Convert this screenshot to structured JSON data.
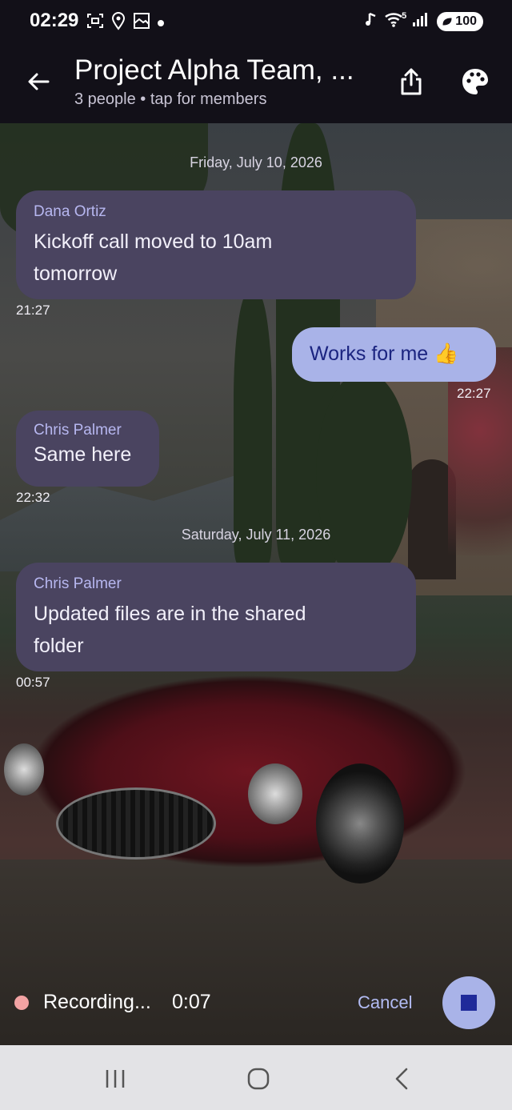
{
  "status_bar": {
    "time": "02:29",
    "left_icons": [
      "screenshot-icon",
      "location-icon",
      "gallery-icon",
      "dot-icon"
    ],
    "right_icons": [
      "music-icon",
      "wifi-icon",
      "signal-icon"
    ],
    "wifi_badge": "5",
    "battery": "100"
  },
  "header": {
    "title": "Project Alpha Team, ...",
    "subtitle": "3 people • tap for members",
    "back_icon": "arrow-left-icon",
    "share_icon": "share-icon",
    "palette_icon": "palette-icon"
  },
  "chat": {
    "date_separators": [
      "Friday, July 10, 2026",
      "Saturday, July 11, 2026"
    ],
    "messages": [
      {
        "direction": "in",
        "sender": "Dana Ortiz",
        "text_line1": "Kickoff call moved to 10am",
        "text_line2": "tomorrow",
        "time": "21:27"
      },
      {
        "direction": "out",
        "text": "Works for me 👍",
        "time": "22:27"
      },
      {
        "direction": "in",
        "sender": "Chris Palmer",
        "text": "Same here",
        "time": "22:32"
      },
      {
        "direction": "in",
        "sender": "Chris Palmer",
        "text_line1": "Updated files are in the shared",
        "text_line2": "folder",
        "time": "00:57"
      }
    ]
  },
  "recorder": {
    "label": "Recording...",
    "timer": "0:07",
    "cancel_label": "Cancel",
    "stop_icon": "stop-icon"
  },
  "nav_bar": {
    "icons": [
      "recents-icon",
      "home-icon",
      "back-icon"
    ]
  },
  "colors": {
    "bar_bg": "#121018",
    "incoming_bubble": "#4a4460",
    "outgoing_bubble": "#a9b3e8",
    "outgoing_text": "#1b2480",
    "sender_name": "#b7b7f0",
    "accent": "#b3bcf4",
    "record_dot": "#f2a3a3"
  }
}
